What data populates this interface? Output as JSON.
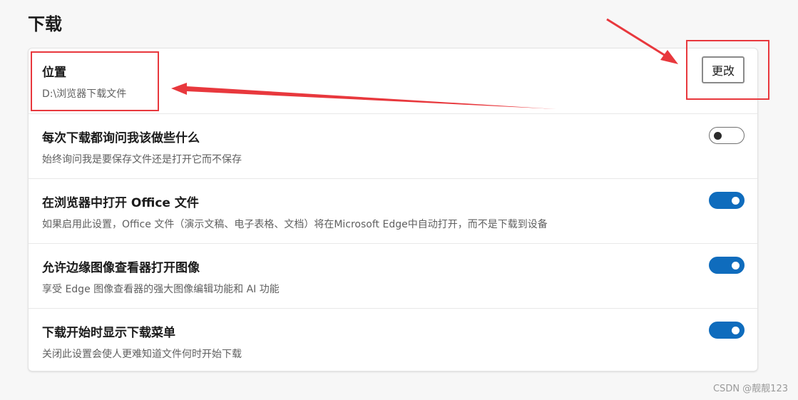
{
  "section": {
    "title": "下载"
  },
  "location": {
    "title": "位置",
    "path": "D:\\浏览器下载文件",
    "change_label": "更改"
  },
  "settings": [
    {
      "title": "每次下载都询问我该做些什么",
      "description": "始终询问我是要保存文件还是打开它而不保存",
      "enabled": false
    },
    {
      "title": "在浏览器中打开 Office 文件",
      "description": "如果启用此设置，Office 文件（演示文稿、电子表格、文档）将在Microsoft Edge中自动打开，而不是下载到设备",
      "enabled": true
    },
    {
      "title": "允许边缘图像查看器打开图像",
      "description": "享受 Edge 图像查看器的强大图像编辑功能和 AI 功能",
      "enabled": true
    },
    {
      "title": "下载开始时显示下载菜单",
      "description": "关闭此设置会使人更难知道文件何时开始下载",
      "enabled": true
    }
  ],
  "watermark": "CSDN @靓靓123",
  "colors": {
    "accent": "#0f6cbd",
    "annotation": "#e8383d",
    "background": "#f7f7f7",
    "card": "#ffffff"
  }
}
